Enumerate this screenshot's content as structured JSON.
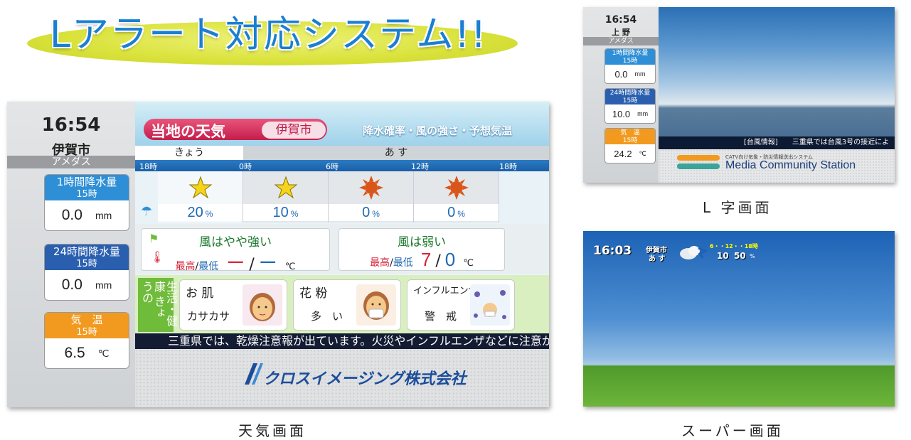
{
  "banner": {
    "title": "Lアラート対応システム!!"
  },
  "weather_screen": {
    "time": "16:54",
    "city": "伊賀市",
    "station": "アメダス",
    "stats": [
      {
        "label": "1時間降水量",
        "hour": "15時",
        "value": "0.0",
        "unit": "mm",
        "color": "#2e8fd6"
      },
      {
        "label": "24時間降水量",
        "hour": "15時",
        "value": "0.0",
        "unit": "mm",
        "color": "#2a5fb0"
      },
      {
        "label": "気　温",
        "hour": "15時",
        "value": "6.5",
        "unit": "℃",
        "color": "#f29a1f"
      }
    ],
    "header": {
      "title": "当地の天気",
      "city": "伊賀市",
      "subtitle": "降水確率・風の強さ・予想気温"
    },
    "days": {
      "today": "きょう",
      "tomorrow": "あ す"
    },
    "hours": [
      "18時",
      "0時",
      "6時",
      "12時",
      "18時"
    ],
    "forecast": [
      {
        "icon": "star-icon",
        "pct": "20",
        "unit": "%"
      },
      {
        "icon": "star-icon",
        "pct": "10",
        "unit": "%"
      },
      {
        "icon": "sun-icon",
        "pct": "0",
        "unit": "%"
      },
      {
        "icon": "sun-icon",
        "pct": "0",
        "unit": "%"
      }
    ],
    "wind_today": {
      "text": "風はやや強い",
      "hi_label": "最高",
      "lo_label": "最低",
      "hi": "ー",
      "lo": "ー",
      "unit": "℃"
    },
    "wind_tomorrow": {
      "text": "風は弱い",
      "hi_label": "最高",
      "lo_label": "最低",
      "hi": "7",
      "lo": "0",
      "unit": "℃"
    },
    "life": {
      "tag": "生活・健康 きょうの",
      "cards": [
        {
          "title": "お 肌",
          "value": "カサカサ"
        },
        {
          "title": "花 粉",
          "value": "多　い"
        },
        {
          "title": "インフルエンザ",
          "value": "警　戒"
        }
      ]
    },
    "ticker": "三重県では、乾燥注意報が出ています。火災やインフルエンザなどに注意が",
    "logo": "クロスイメージング株式会社"
  },
  "captions": {
    "weather": "天気画面",
    "l_screen": "L 字画面",
    "super_screen": "スーパー画面"
  },
  "l_screen": {
    "time": "16:54",
    "city": "上 野",
    "station": "アメダス",
    "stats": [
      {
        "label": "1時間降水量",
        "hour": "15時",
        "value": "0.0",
        "unit": "mm",
        "color": "#2e8fd6"
      },
      {
        "label": "24時間降水量",
        "hour": "15時",
        "value": "10.0",
        "unit": "mm",
        "color": "#2a5fb0"
      },
      {
        "label": "気　温",
        "hour": "15時",
        "value": "24.2",
        "unit": "℃",
        "color": "#f29a1f"
      }
    ],
    "ticker": "[台風情報]　　三重県では台風3号の接近によ",
    "footer_small": "CATV向け気象・防災情報送出システム",
    "footer_title": "Media Community Station"
  },
  "super_screen": {
    "time": "16:03",
    "city": "伊賀市",
    "day": "あ す",
    "hours": "6・・12・・18時",
    "pct1": "10",
    "pct2": "50",
    "unit": "%"
  }
}
